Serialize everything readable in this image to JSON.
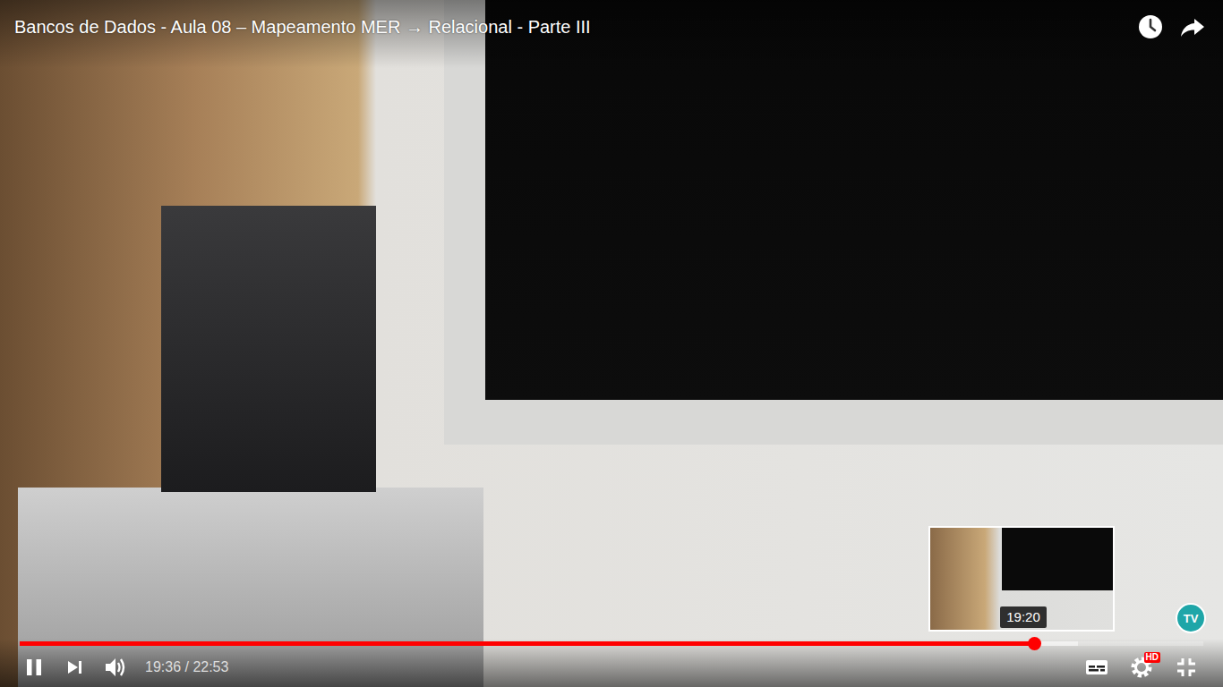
{
  "player": {
    "title": "Bancos de Dados - Aula 08 – Mapeamento MER → Relacional - Parte III",
    "playing": true,
    "muted": false,
    "fullscreen": true,
    "captions_on": false,
    "time_display": "19:36 / 22:53",
    "quality_badge": "HD",
    "watermark": "TV"
  },
  "progress": {
    "level": 0.857,
    "buffered": 0.894
  },
  "preview": {
    "time": "19:20"
  }
}
